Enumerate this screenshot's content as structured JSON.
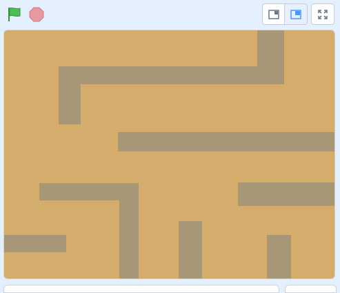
{
  "icons": {
    "green_flag": "green-flag-icon",
    "stop": "stop-icon",
    "small_stage": "small-stage-icon",
    "normal_stage": "normal-stage-icon",
    "fullscreen": "fullscreen-icon"
  },
  "colors": {
    "page_background": "#e5f0ff",
    "stage_floor": "#d4ad6d",
    "maze_wall": "#a89776",
    "flag_green": "#4cbf56",
    "stop_red": "#e49a9e",
    "selected_mode_blue": "#4c97ff"
  },
  "stage_view": {
    "selected_mode": "normal-stage"
  }
}
